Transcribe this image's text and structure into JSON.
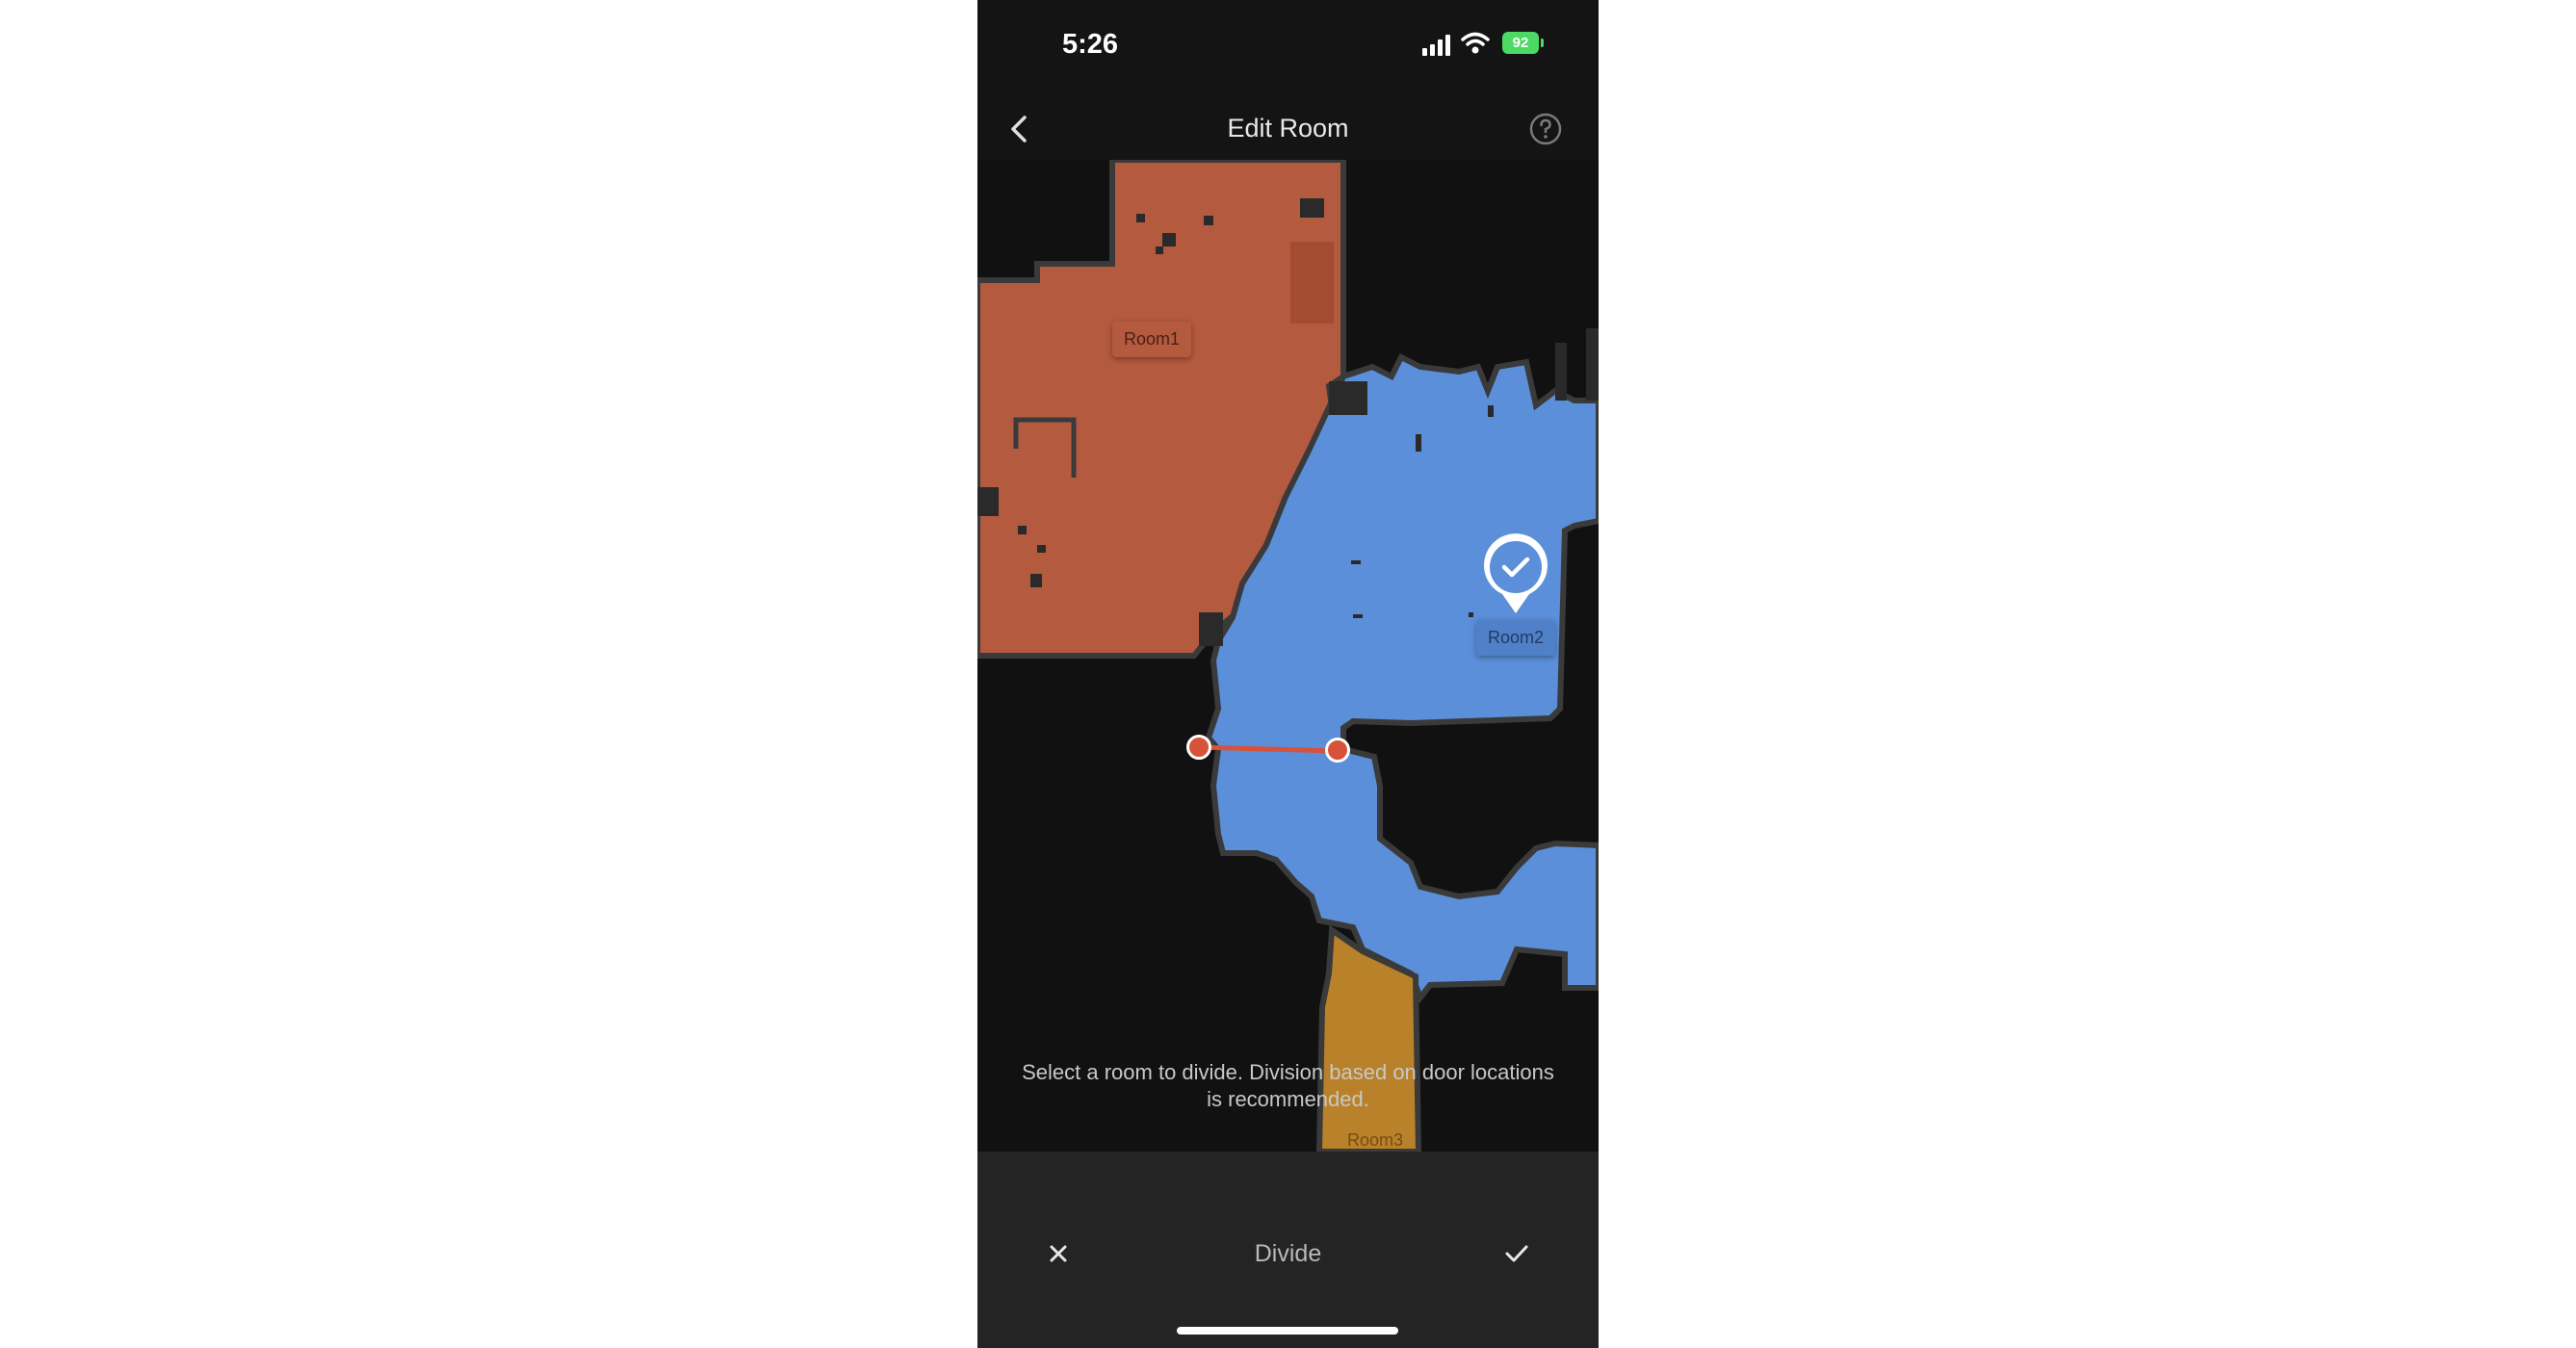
{
  "status_bar": {
    "time": "5:26",
    "battery": "92"
  },
  "nav": {
    "title": "Edit Room",
    "back_icon": "chevron-left-icon",
    "help_icon": "question-circle-icon"
  },
  "map": {
    "rooms": [
      {
        "name": "Room1",
        "color": "#b45a3f"
      },
      {
        "name": "Room2",
        "color": "#5b8fd9",
        "selected": true
      },
      {
        "name": "Room3",
        "color": "#b9822a"
      }
    ],
    "obstacle_color": "#3a3a3a",
    "divider_color": "#d7523b"
  },
  "hint": {
    "text": "Select a room to divide. Division based on door locations is recommended."
  },
  "bottom_bar": {
    "cancel_icon": "close-icon",
    "mode_label": "Divide",
    "confirm_icon": "check-icon"
  }
}
